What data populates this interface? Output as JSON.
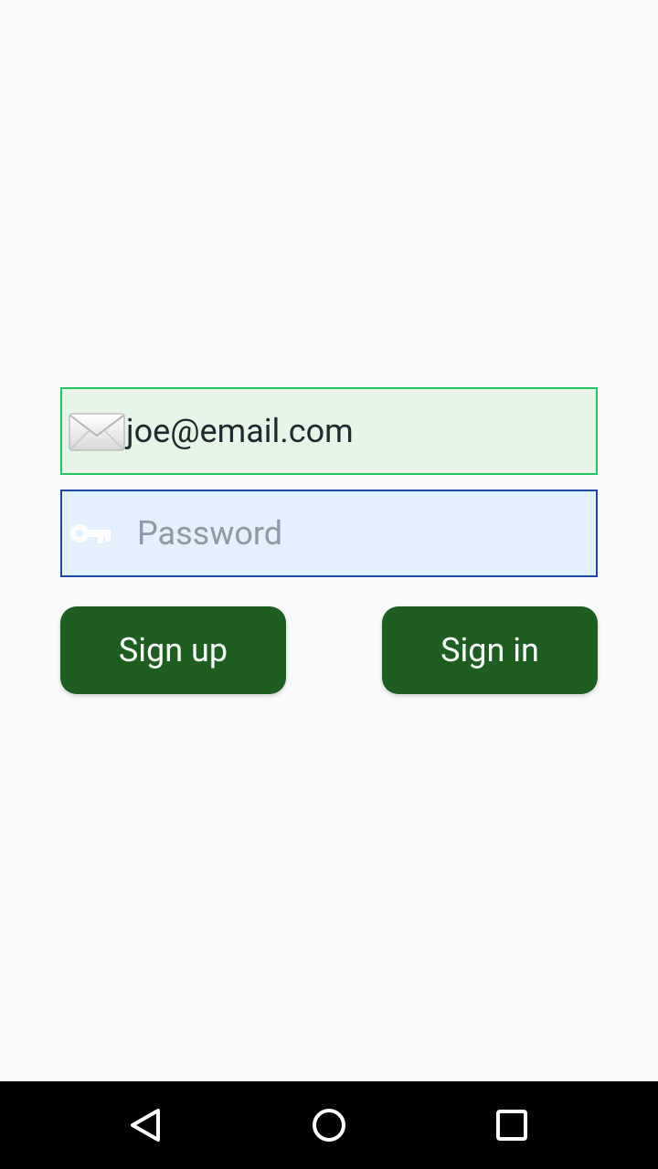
{
  "login": {
    "email": {
      "value": "joe@email.com",
      "icon": "envelope-icon",
      "border_color": "#22c55e",
      "background": "#e6f5e8"
    },
    "password": {
      "value": "",
      "placeholder": "Password",
      "icon": "key-icon",
      "border_color": "#1d4aa0",
      "background": "#e3f0fd"
    },
    "buttons": {
      "sign_up": "Sign up",
      "sign_in": "Sign in",
      "color": "#1e5e21"
    }
  },
  "navigation_bar": {
    "items": [
      "back-icon",
      "home-icon",
      "recents-icon"
    ]
  }
}
